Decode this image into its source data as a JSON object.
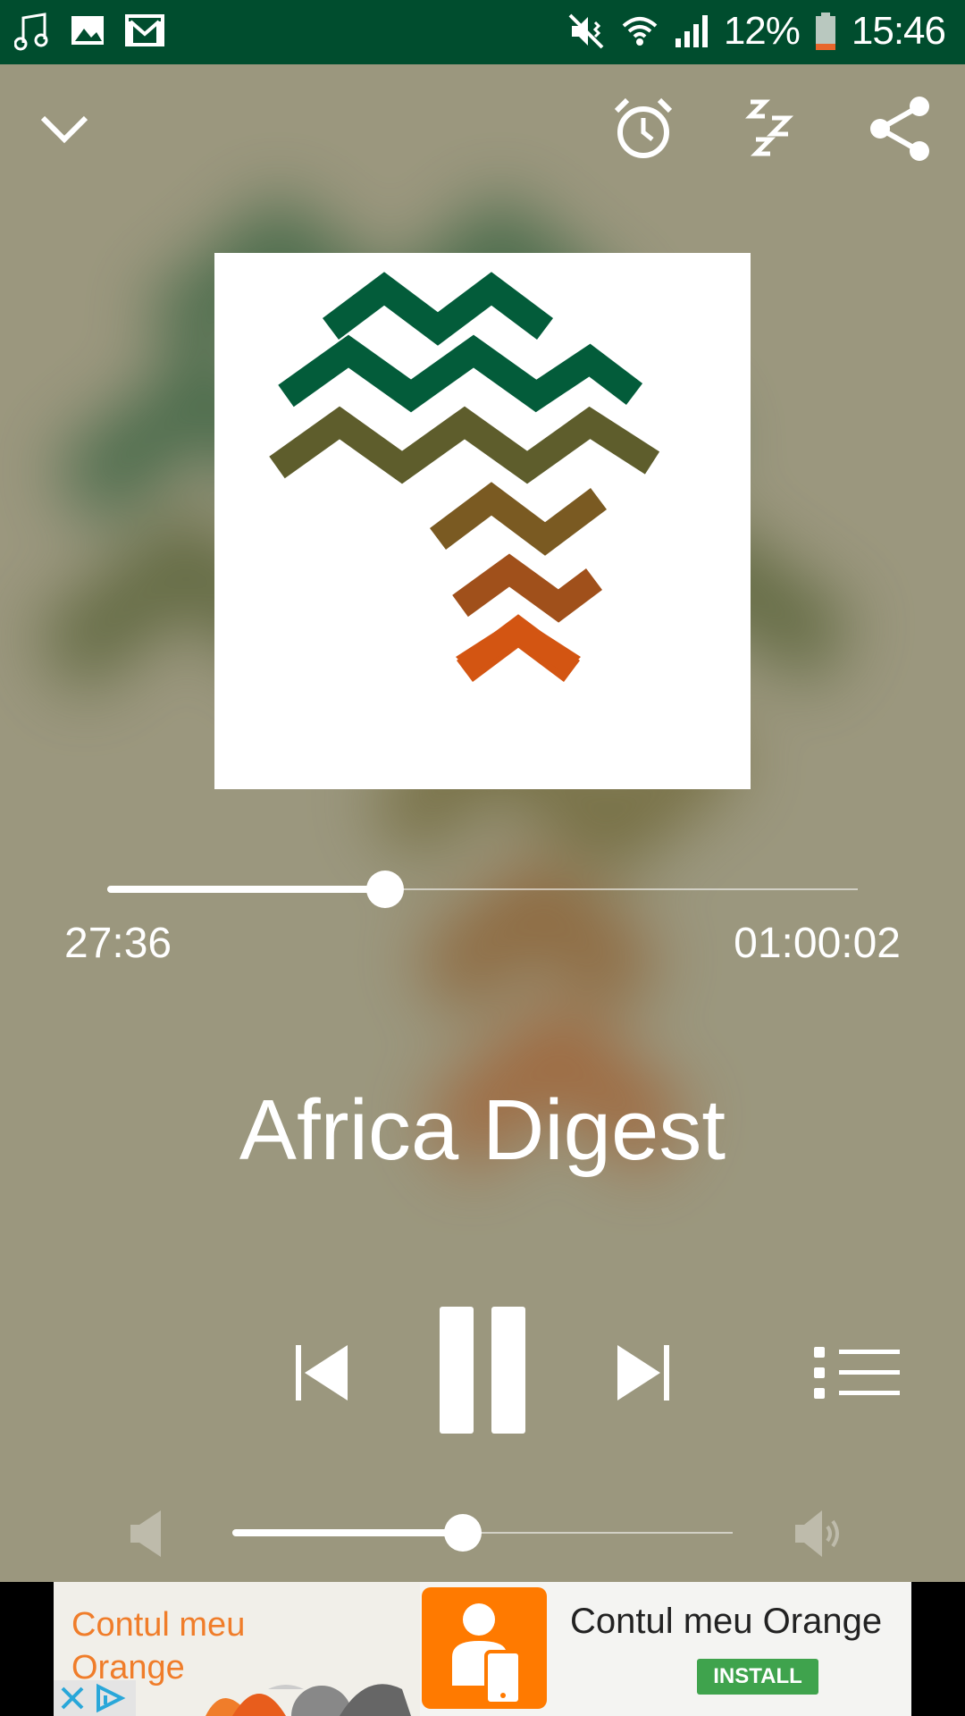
{
  "status_bar": {
    "battery": "12%",
    "time": "15:46",
    "icons": [
      "music-note-icon",
      "image-icon",
      "gmail-icon",
      "mute-vibrate-icon",
      "wifi-icon",
      "signal-icon",
      "battery-icon"
    ]
  },
  "top_bar": {
    "icons": [
      "chevron-down-icon",
      "alarm-clock-icon",
      "sleep-timer-icon",
      "share-icon"
    ]
  },
  "player": {
    "elapsed": "27:36",
    "duration": "01:00:02",
    "progress_fraction": 0.37,
    "title": "Africa Digest",
    "volume_fraction": 0.46
  },
  "controls": [
    "skip-previous-icon",
    "pause-icon",
    "skip-next-icon",
    "playlist-icon"
  ],
  "ad": {
    "brand_text": "Contul meu Orange",
    "app_name": "Contul meu Orange",
    "install_label": "INSTALL"
  },
  "colors": {
    "status_bar": "#004d2e",
    "background": "#9b977e",
    "logo_green": "#035c3a",
    "logo_olive": "#5e5d2c",
    "logo_brown": "#7a5a22",
    "logo_rust": "#a0501b",
    "logo_orange": "#d35512",
    "ad_orange": "#ff7a00",
    "install_green": "#3fa34d"
  }
}
